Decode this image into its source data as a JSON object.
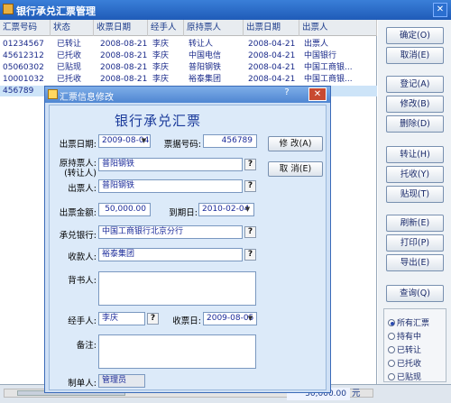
{
  "window": {
    "title": "银行承兑汇票管理",
    "close_glyph": "✕"
  },
  "table": {
    "columns": [
      "汇票号码",
      "状态",
      "收票日期",
      "经手人",
      "原持票人",
      "出票日期",
      "出票人"
    ],
    "rows": [
      [
        "01234567",
        "已转让",
        "2008-08-21",
        "李庆",
        "转让人",
        "2008-04-21",
        "出票人"
      ],
      [
        "45612312",
        "已托收",
        "2008-08-21",
        "李庆",
        "中国电信",
        "2008-04-21",
        "中国银行"
      ],
      [
        "05060302",
        "已贴现",
        "2008-08-21",
        "李庆",
        "普阳钢铁",
        "2008-04-21",
        "中国工商银..."
      ],
      [
        "10001032",
        "已托收",
        "2008-08-21",
        "李庆",
        "裕泰集团",
        "2008-04-21",
        "中国工商银..."
      ],
      [
        "456789",
        "",
        "",
        "",
        "",
        "",
        ""
      ]
    ]
  },
  "footer": {
    "total": "50,000.00",
    "unit": "元"
  },
  "buttons": {
    "confirm": "确定(O)",
    "cancel": "取消(E)",
    "register": "登记(A)",
    "modify": "修改(B)",
    "delete": "删除(D)",
    "transfer": "转让(H)",
    "collect": "托收(Y)",
    "discount": "贴现(T)",
    "refresh": "刷新(E)",
    "print": "打印(P)",
    "export": "导出(E)",
    "query": "查询(Q)"
  },
  "filter": {
    "options": [
      "所有汇票",
      "持有中",
      "已转让",
      "已托收",
      "已贴现"
    ],
    "selected_index": 0
  },
  "dialog": {
    "title": "汇票信息修改",
    "heading": "银行承兑汇票",
    "help_glyph": "?",
    "close_glyph": "✕",
    "issue_date_label": "出票日期:",
    "issue_date": "2009-08-04",
    "bill_no_label": "票据号码:",
    "bill_no": "456789",
    "modify_btn": "修 改(A)",
    "cancel_btn": "取 消(E)",
    "orig_holder_label": "原持票人:",
    "orig_holder_sub": "(转让人)",
    "orig_holder": "普阳钢铁",
    "drawer_label": "出票人:",
    "drawer": "普阳钢铁",
    "amount_label": "出票金额:",
    "amount": "50,000.00",
    "due_label": "到期日:",
    "due_date": "2010-02-04",
    "accept_bank_label": "承兑银行:",
    "accept_bank": "中国工商银行北京分行",
    "payee_label": "收款人:",
    "payee": "裕泰集团",
    "endorser_label": "背书人:",
    "handler_label": "经手人:",
    "handler": "李庆",
    "recv_date_label": "收票日:",
    "recv_date": "2009-08-05",
    "note_label": "备注:",
    "creator_label": "制单人:",
    "creator": "管理员",
    "question_glyph": "?",
    "dropdown_glyph": "▼"
  }
}
